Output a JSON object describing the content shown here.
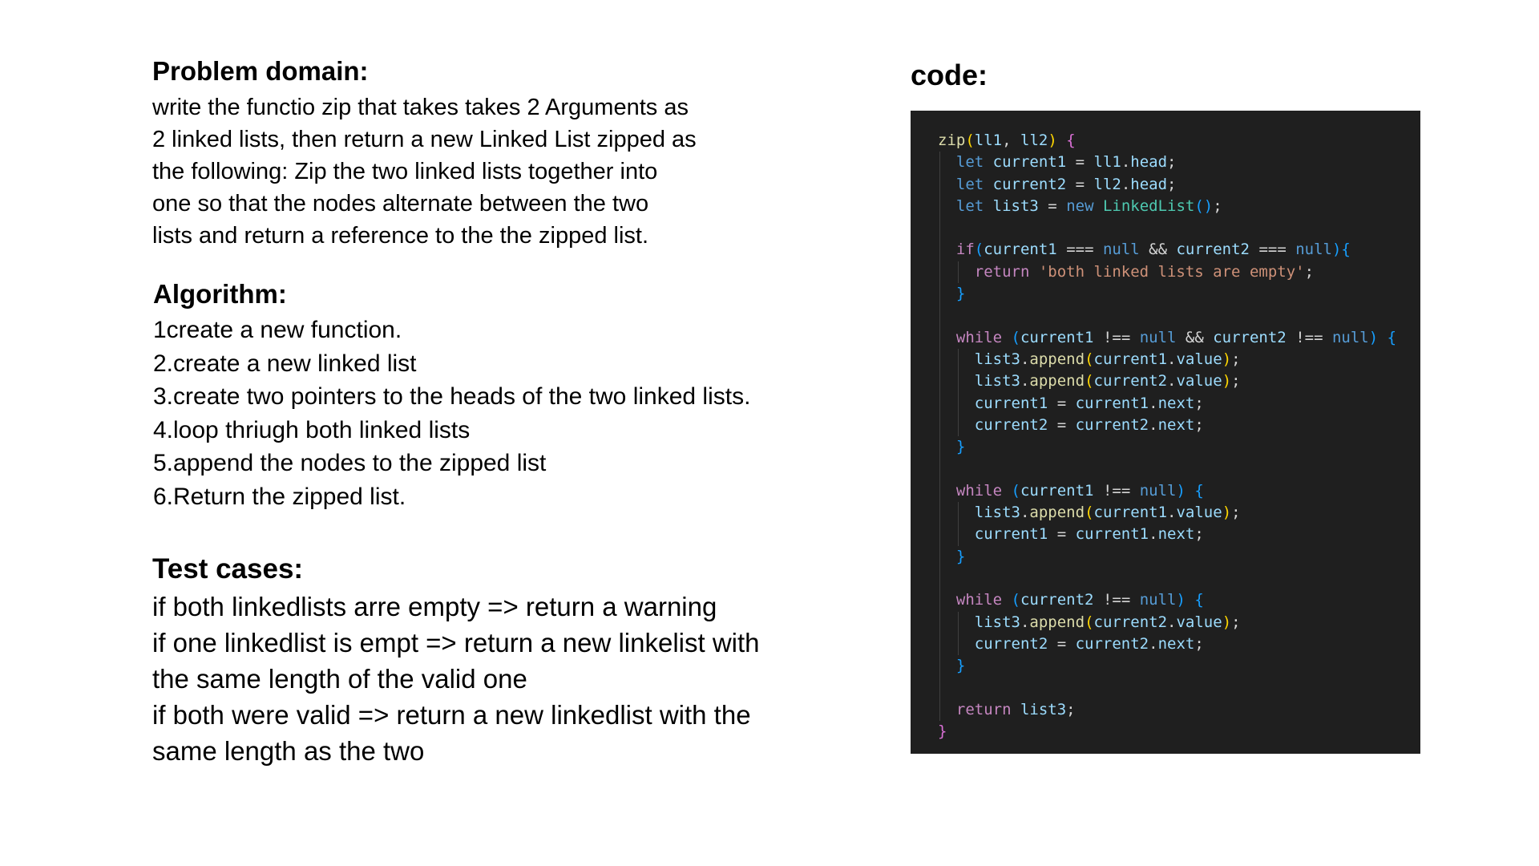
{
  "problem": {
    "heading": "Problem domain:",
    "lines": [
      "write the functio zip that takes takes 2 Arguments as",
      "2 linked lists, then return a new Linked List zipped as",
      "the following: Zip the two linked lists together into",
      "one so that the nodes alternate between the two",
      "lists and return a reference to the the zipped list."
    ]
  },
  "algorithm": {
    "heading": "Algorithm:",
    "steps": [
      "1create a new function.",
      "2.create a new linked list",
      "3.create two pointers to the heads of the two linked lists.",
      "4.loop thriugh both linked lists",
      "5.append the nodes to the zipped list",
      "6.Return the zipped list."
    ]
  },
  "tests": {
    "heading": "Test cases:",
    "lines": [
      "if both linkedlists arre empty => return a warning",
      "if one linkedlist is empt => return a new linkelist with",
      "the same length of the valid one",
      "if both were valid => return a new linkedlist with the",
      "same length as the two"
    ]
  },
  "code": {
    "heading": "code:",
    "lines": [
      {
        "indent": 0,
        "tokens": [
          [
            "zip",
            "fn"
          ],
          [
            "(",
            "b1"
          ],
          [
            "ll1",
            "var"
          ],
          [
            ", ",
            "op"
          ],
          [
            "ll2",
            "var"
          ],
          [
            ") ",
            "b1"
          ],
          [
            "{",
            "b2"
          ]
        ]
      },
      {
        "indent": 1,
        "tokens": [
          [
            "let ",
            "kw"
          ],
          [
            "current1",
            "var"
          ],
          [
            " = ",
            "op"
          ],
          [
            "ll1",
            "var"
          ],
          [
            ".",
            "op"
          ],
          [
            "head",
            "var"
          ],
          [
            ";",
            "op"
          ]
        ]
      },
      {
        "indent": 1,
        "tokens": [
          [
            "let ",
            "kw"
          ],
          [
            "current2",
            "var"
          ],
          [
            " = ",
            "op"
          ],
          [
            "ll2",
            "var"
          ],
          [
            ".",
            "op"
          ],
          [
            "head",
            "var"
          ],
          [
            ";",
            "op"
          ]
        ]
      },
      {
        "indent": 1,
        "tokens": [
          [
            "let ",
            "kw"
          ],
          [
            "list3",
            "var"
          ],
          [
            " = ",
            "op"
          ],
          [
            "new ",
            "kw"
          ],
          [
            "LinkedList",
            "cls"
          ],
          [
            "()",
            "b3"
          ],
          [
            ";",
            "op"
          ]
        ]
      },
      {
        "indent": 1,
        "tokens": []
      },
      {
        "indent": 1,
        "tokens": [
          [
            "if",
            "ctrl"
          ],
          [
            "(",
            "b3"
          ],
          [
            "current1",
            "var"
          ],
          [
            " === ",
            "op"
          ],
          [
            "null",
            "kw"
          ],
          [
            " && ",
            "op"
          ],
          [
            "current2",
            "var"
          ],
          [
            " === ",
            "op"
          ],
          [
            "null",
            "kw"
          ],
          [
            "){",
            "b3"
          ]
        ]
      },
      {
        "indent": 2,
        "tokens": [
          [
            "return ",
            "ctrl"
          ],
          [
            "'both linked lists are empty'",
            "str"
          ],
          [
            ";",
            "op"
          ]
        ]
      },
      {
        "indent": 1,
        "tokens": [
          [
            "}",
            "b3"
          ]
        ]
      },
      {
        "indent": 1,
        "tokens": []
      },
      {
        "indent": 1,
        "tokens": [
          [
            "while ",
            "ctrl"
          ],
          [
            "(",
            "b3"
          ],
          [
            "current1",
            "var"
          ],
          [
            " !== ",
            "op"
          ],
          [
            "null",
            "kw"
          ],
          [
            " && ",
            "op"
          ],
          [
            "current2",
            "var"
          ],
          [
            " !== ",
            "op"
          ],
          [
            "null",
            "kw"
          ],
          [
            ") {",
            "b3"
          ]
        ]
      },
      {
        "indent": 2,
        "tokens": [
          [
            "list3",
            "var"
          ],
          [
            ".",
            "op"
          ],
          [
            "append",
            "fn"
          ],
          [
            "(",
            "b1"
          ],
          [
            "current1",
            "var"
          ],
          [
            ".",
            "op"
          ],
          [
            "value",
            "var"
          ],
          [
            ")",
            "b1"
          ],
          [
            ";",
            "op"
          ]
        ]
      },
      {
        "indent": 2,
        "tokens": [
          [
            "list3",
            "var"
          ],
          [
            ".",
            "op"
          ],
          [
            "append",
            "fn"
          ],
          [
            "(",
            "b1"
          ],
          [
            "current2",
            "var"
          ],
          [
            ".",
            "op"
          ],
          [
            "value",
            "var"
          ],
          [
            ")",
            "b1"
          ],
          [
            ";",
            "op"
          ]
        ]
      },
      {
        "indent": 2,
        "tokens": [
          [
            "current1",
            "var"
          ],
          [
            " = ",
            "op"
          ],
          [
            "current1",
            "var"
          ],
          [
            ".",
            "op"
          ],
          [
            "next",
            "var"
          ],
          [
            ";",
            "op"
          ]
        ]
      },
      {
        "indent": 2,
        "tokens": [
          [
            "current2",
            "var"
          ],
          [
            " = ",
            "op"
          ],
          [
            "current2",
            "var"
          ],
          [
            ".",
            "op"
          ],
          [
            "next",
            "var"
          ],
          [
            ";",
            "op"
          ]
        ]
      },
      {
        "indent": 1,
        "tokens": [
          [
            "}",
            "b3"
          ]
        ]
      },
      {
        "indent": 1,
        "tokens": []
      },
      {
        "indent": 1,
        "tokens": [
          [
            "while ",
            "ctrl"
          ],
          [
            "(",
            "b3"
          ],
          [
            "current1",
            "var"
          ],
          [
            " !== ",
            "op"
          ],
          [
            "null",
            "kw"
          ],
          [
            ") {",
            "b3"
          ]
        ]
      },
      {
        "indent": 2,
        "tokens": [
          [
            "list3",
            "var"
          ],
          [
            ".",
            "op"
          ],
          [
            "append",
            "fn"
          ],
          [
            "(",
            "b1"
          ],
          [
            "current1",
            "var"
          ],
          [
            ".",
            "op"
          ],
          [
            "value",
            "var"
          ],
          [
            ")",
            "b1"
          ],
          [
            ";",
            "op"
          ]
        ]
      },
      {
        "indent": 2,
        "tokens": [
          [
            "current1",
            "var"
          ],
          [
            " = ",
            "op"
          ],
          [
            "current1",
            "var"
          ],
          [
            ".",
            "op"
          ],
          [
            "next",
            "var"
          ],
          [
            ";",
            "op"
          ]
        ]
      },
      {
        "indent": 1,
        "tokens": [
          [
            "}",
            "b3"
          ]
        ]
      },
      {
        "indent": 1,
        "tokens": []
      },
      {
        "indent": 1,
        "tokens": [
          [
            "while ",
            "ctrl"
          ],
          [
            "(",
            "b3"
          ],
          [
            "current2",
            "var"
          ],
          [
            " !== ",
            "op"
          ],
          [
            "null",
            "kw"
          ],
          [
            ") {",
            "b3"
          ]
        ]
      },
      {
        "indent": 2,
        "tokens": [
          [
            "list3",
            "var"
          ],
          [
            ".",
            "op"
          ],
          [
            "append",
            "fn"
          ],
          [
            "(",
            "b1"
          ],
          [
            "current2",
            "var"
          ],
          [
            ".",
            "op"
          ],
          [
            "value",
            "var"
          ],
          [
            ")",
            "b1"
          ],
          [
            ";",
            "op"
          ]
        ]
      },
      {
        "indent": 2,
        "tokens": [
          [
            "current2",
            "var"
          ],
          [
            " = ",
            "op"
          ],
          [
            "current2",
            "var"
          ],
          [
            ".",
            "op"
          ],
          [
            "next",
            "var"
          ],
          [
            ";",
            "op"
          ]
        ]
      },
      {
        "indent": 1,
        "tokens": [
          [
            "}",
            "b3"
          ]
        ]
      },
      {
        "indent": 1,
        "tokens": []
      },
      {
        "indent": 1,
        "tokens": [
          [
            "return ",
            "ctrl"
          ],
          [
            "list3",
            "var"
          ],
          [
            ";",
            "op"
          ]
        ]
      },
      {
        "indent": 0,
        "tokens": [
          [
            "}",
            "b2"
          ]
        ]
      }
    ]
  }
}
